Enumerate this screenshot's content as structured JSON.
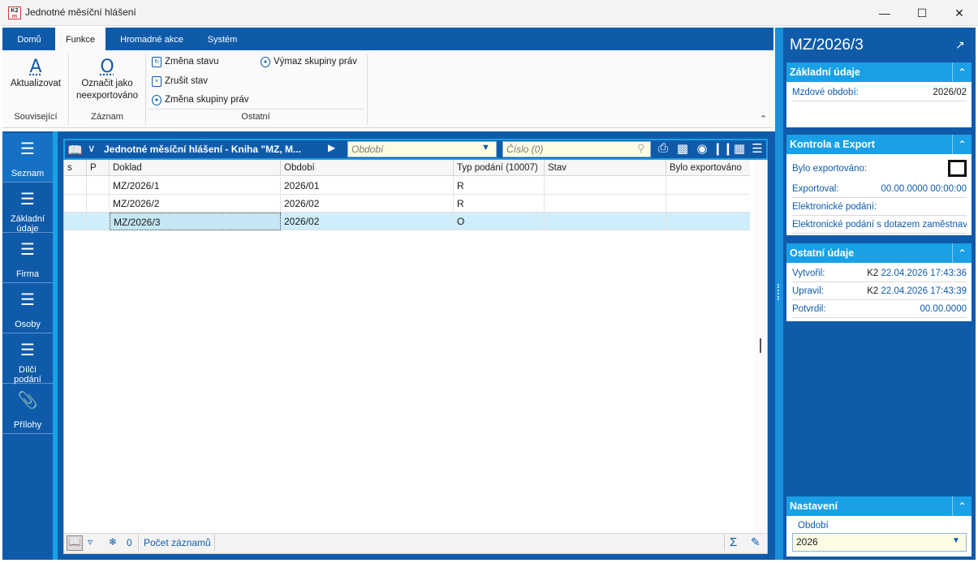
{
  "window": {
    "title": "Jednotné měsíční hlášení",
    "logo_top": "K2",
    "logo_bottom": "m"
  },
  "ribbon": {
    "tabs": [
      "Domů",
      "Funkce",
      "Hromadné akce",
      "Systém"
    ],
    "active_tab": "Funkce",
    "groups": {
      "souvisejici": {
        "label": "Související",
        "button": "Aktualizovat",
        "icon_char": "A"
      },
      "zaznam": {
        "label": "Záznam",
        "button_line1": "Označit jako",
        "button_line2": "neexportováno",
        "icon_char": "O"
      },
      "ostatni": {
        "label": "Ostatní",
        "items": [
          "Změna stavu",
          "Zrušit stav",
          "Změna skupiny práv",
          "Výmaz skupiny práv"
        ]
      }
    }
  },
  "nav": {
    "items": [
      {
        "label": "Seznam",
        "icon": "list-icon"
      },
      {
        "label_line1": "Základní",
        "label_line2": "údaje",
        "icon": "list-icon"
      },
      {
        "label": "Firma",
        "icon": "list-icon"
      },
      {
        "label": "Osoby",
        "icon": "list-icon"
      },
      {
        "label_line1": "Dílčí",
        "label_line2": "podání",
        "icon": "list-icon"
      },
      {
        "label": "Přílohy",
        "icon": "paperclip-icon"
      }
    ]
  },
  "grid": {
    "title": "Jednotné měsíční hlášení - Kniha \"MZ, M...",
    "period_placeholder": "Období",
    "number_placeholder": "Číslo (0)",
    "columns": [
      "s",
      "P",
      "Doklad",
      "Období",
      "Typ podání (10007)",
      "Stav",
      "Bylo exportováno"
    ],
    "rows": [
      {
        "doklad": "MZ/2026/1",
        "obdobi": "2026/01",
        "typ": "R"
      },
      {
        "doklad": "MZ/2026/2",
        "obdobi": "2026/02",
        "typ": "R"
      },
      {
        "doklad": "MZ/2026/3",
        "obdobi": "2026/02",
        "typ": "O"
      }
    ],
    "footer": {
      "count": "0",
      "records_label": "Počet záznamů"
    }
  },
  "detail": {
    "title": "MZ/2026/3",
    "zakladni": {
      "header": "Základní údaje",
      "mzdove_label": "Mzdové období:",
      "mzdove_value": "2026/02"
    },
    "kontrola": {
      "header": "Kontrola a Export",
      "exportovano_label": "Bylo exportováno:",
      "exportoval_label": "Exportoval:",
      "exportoval_value": "00.00.0000 00:00:00",
      "el_podani_label": "Elektronické podání:",
      "el_podani_dotaz_label": "Elektronické podání s dotazem zaměstnav"
    },
    "ostatni": {
      "header": "Ostatní údaje",
      "vytvoril_label": "Vytvořil:",
      "vytvoril_user": "K2",
      "vytvoril_date": "22.04.2026 17:43:36",
      "upravil_label": "Upravil:",
      "upravil_user": "K2",
      "upravil_date": "22.04.2026 17:43:39",
      "potvrdil_label": "Potvrdil:",
      "potvrdil_value": "00.00.0000"
    },
    "nastaveni": {
      "header": "Nastavení",
      "obdobi_label": "Období",
      "obdobi_value": "2026"
    }
  }
}
